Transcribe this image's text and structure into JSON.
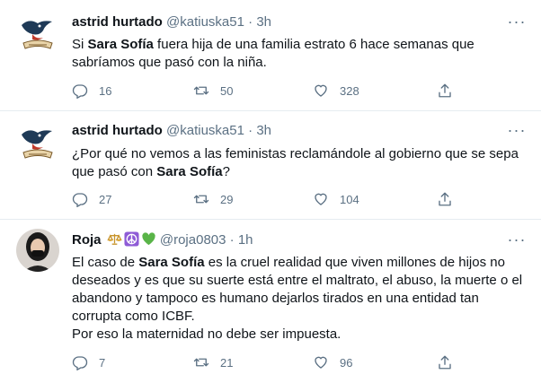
{
  "tweets": [
    {
      "name": "astrid hurtado",
      "handle": "@katiuska51",
      "dot": "·",
      "time": "3h",
      "text_before": "Si ",
      "text_bold": "Sara Sofía",
      "text_after": " fuera hija de una familia estrato 6 hace semanas que sabríamos que pasó con la niña.",
      "replies": "16",
      "retweets": "50",
      "likes": "328"
    },
    {
      "name": "astrid hurtado",
      "handle": "@katiuska51",
      "dot": "·",
      "time": "3h",
      "text_before": "¿Por qué no vemos a las feministas reclamándole al gobierno que se sepa que pasó con ",
      "text_bold": "Sara Sofía",
      "text_after": "?",
      "replies": "27",
      "retweets": "29",
      "likes": "104"
    },
    {
      "name": "Roja",
      "name_emoji": [
        "scales-icon",
        "peace-symbol-icon",
        "green-heart-icon"
      ],
      "handle": "@roja0803",
      "dot": "·",
      "time": "1h",
      "text_before": "El caso de ",
      "text_bold": "Sara Sofía",
      "text_after": " es la cruel realidad que viven millones de hijos no deseados y es que su suerte está entre el maltrato, el abuso, la muerte o el abandono y tampoco es humano dejarlos tirados en una entidad tan corrupta como ICBF.",
      "text_line2": "Por eso la maternidad no debe ser impuesta.",
      "replies": "7",
      "retweets": "21",
      "likes": "96"
    }
  ],
  "icons": {
    "reply": "reply-icon",
    "retweet": "retweet-icon",
    "like": "heart-icon",
    "share": "share-icon",
    "more": "more-icon"
  },
  "colors": {
    "text": "#0f1419",
    "secondary": "#5b7083",
    "border": "#e6ecf0"
  }
}
